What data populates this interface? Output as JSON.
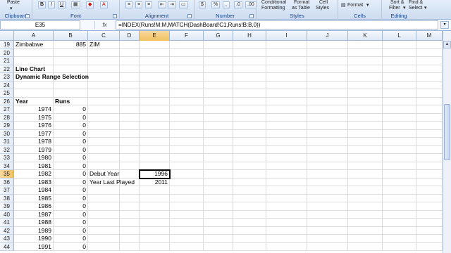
{
  "ribbon": {
    "groups": [
      {
        "label": "Clipboard",
        "items": [
          "Paste"
        ]
      },
      {
        "label": "Font",
        "items": [
          "B",
          "I",
          "U",
          "A"
        ]
      },
      {
        "label": "Alignment",
        "items": []
      },
      {
        "label": "Number",
        "items": [
          "$",
          "%",
          ","
        ]
      },
      {
        "label": "Styles",
        "items": [
          "Conditional",
          "Formatting",
          "Format",
          "as Table",
          "Cell",
          "Styles"
        ]
      },
      {
        "label": "Cells",
        "items": [
          "Format"
        ]
      },
      {
        "label": "Editing",
        "items": [
          "Sort &",
          "Filter",
          "Find &",
          "Select"
        ]
      }
    ]
  },
  "formula_bar": {
    "name_box": "E35",
    "fx": "fx",
    "formula": "=INDEX(Runs!M:M,MATCH(DashBoard!C1,Runs!B:B,0))"
  },
  "columns": [
    "A",
    "B",
    "C",
    "D",
    "E",
    "F",
    "G",
    "H",
    "I",
    "J",
    "K",
    "L",
    "M"
  ],
  "selected_column": "E",
  "selected_row": "35",
  "rows": [
    {
      "num": "19",
      "A": "Zimbabwe",
      "B": "885",
      "C": "ZIM"
    },
    {
      "num": "20"
    },
    {
      "num": "21"
    },
    {
      "num": "22",
      "A": "Line Chart",
      "A_bold": true
    },
    {
      "num": "23",
      "A": "Dynamic Range Selection",
      "A_bold": true
    },
    {
      "num": "24"
    },
    {
      "num": "25"
    },
    {
      "num": "26",
      "A": "Year",
      "B": "Runs",
      "A_bold": true,
      "B_bold": true,
      "B_left": true
    },
    {
      "num": "27",
      "A": "1974",
      "B": "0"
    },
    {
      "num": "28",
      "A": "1975",
      "B": "0"
    },
    {
      "num": "29",
      "A": "1976",
      "B": "0"
    },
    {
      "num": "30",
      "A": "1977",
      "B": "0"
    },
    {
      "num": "31",
      "A": "1978",
      "B": "0"
    },
    {
      "num": "32",
      "A": "1979",
      "B": "0"
    },
    {
      "num": "33",
      "A": "1980",
      "B": "0"
    },
    {
      "num": "34",
      "A": "1981",
      "B": "0"
    },
    {
      "num": "35",
      "A": "1982",
      "B": "0",
      "C": "Debut Year",
      "E": "1996"
    },
    {
      "num": "36",
      "A": "1983",
      "B": "0",
      "C": "Year Last Played",
      "E": "2011"
    },
    {
      "num": "37",
      "A": "1984",
      "B": "0"
    },
    {
      "num": "38",
      "A": "1985",
      "B": "0"
    },
    {
      "num": "39",
      "A": "1986",
      "B": "0"
    },
    {
      "num": "40",
      "A": "1987",
      "B": "0"
    },
    {
      "num": "41",
      "A": "1988",
      "B": "0"
    },
    {
      "num": "42",
      "A": "1989",
      "B": "0"
    },
    {
      "num": "43",
      "A": "1990",
      "B": "0"
    },
    {
      "num": "44",
      "A": "1991",
      "B": "0"
    }
  ]
}
